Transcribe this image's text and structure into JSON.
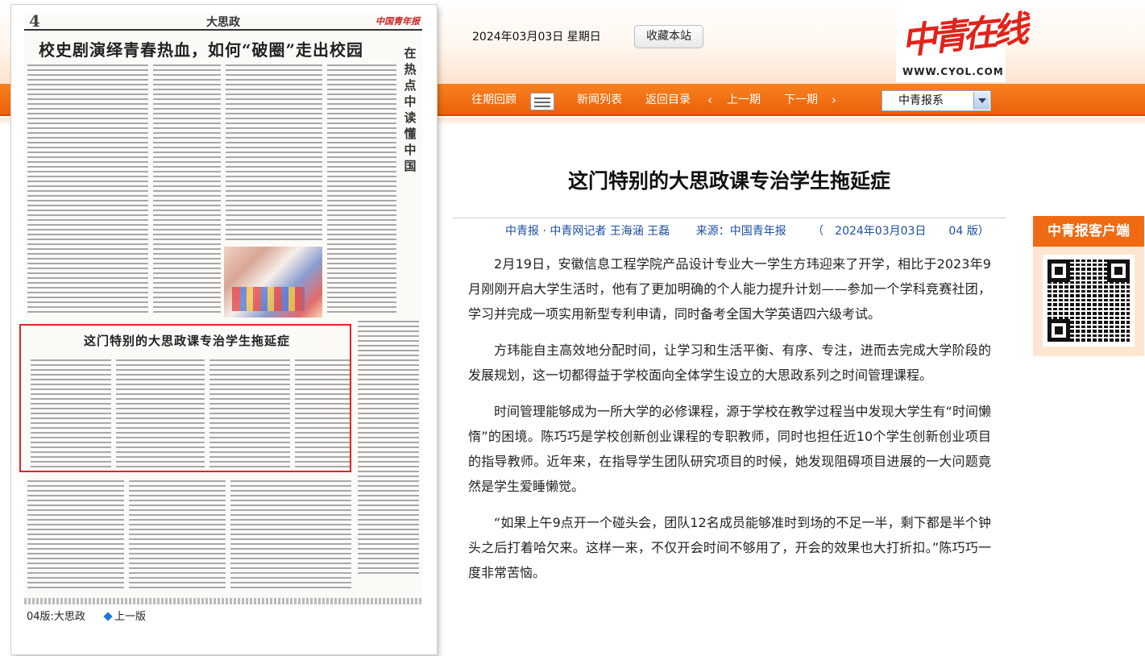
{
  "header": {
    "date": "2024年03月03日 星期日",
    "bookmark_label": "收藏本站",
    "logo_cn": "中青在线",
    "logo_en": "WWW.CYOL.COM"
  },
  "nav": {
    "items": [
      "往期回顾",
      "新闻列表",
      "返回目录",
      "上一期",
      "下一期"
    ],
    "select_value": "中青报系"
  },
  "paper": {
    "page_number": "4",
    "section": "大思政",
    "masthead": "中国青年报",
    "headline": "校史剧演绎青春热血，如何“破圈”走出校园",
    "vertical_column": "在热点中读懂中国",
    "highlight_title": "这门特别的大思政课专治学生拖延症",
    "page_label": "04版:大思政",
    "prev_page": "上一版"
  },
  "article": {
    "title": "这门特别的大思政课专治学生拖延症",
    "byline": "中青报 · 中青网记者 王海涵 王磊",
    "source": "来源：中国青年报",
    "edition": "（　2024年03月03日　　04 版）",
    "paragraphs": [
      "2月19日，安徽信息工程学院产品设计专业大一学生方玮迎来了开学，相比于2023年9月刚刚开启大学生活时，他有了更加明确的个人能力提升计划——参加一个学科竞赛社团，学习并完成一项实用新型专利申请，同时备考全国大学英语四六级考试。",
      "方玮能自主高效地分配时间，让学习和生活平衡、有序、专注，进而去完成大学阶段的发展规划，这一切都得益于学校面向全体学生设立的大思政系列之时间管理课程。",
      "时间管理能够成为一所大学的必修课程，源于学校在教学过程当中发现大学生有“时间懒惰”的困境。陈巧巧是学校创新创业课程的专职教师，同时也担任近10个学生创新创业项目的指导教师。近年来，在指导学生团队研究项目的时候，她发现阻碍项目进展的一大问题竟然是学生爱睡懒觉。",
      "“如果上午9点开一个碰头会，团队12名成员能够准时到场的不足一半，剩下都是半个钟头之后打着哈欠来。这样一来，不仅开会时间不够用了，开会的效果也大打折扣。”陈巧巧一度非常苦恼。"
    ]
  },
  "client": {
    "title": "中青报客户端"
  }
}
